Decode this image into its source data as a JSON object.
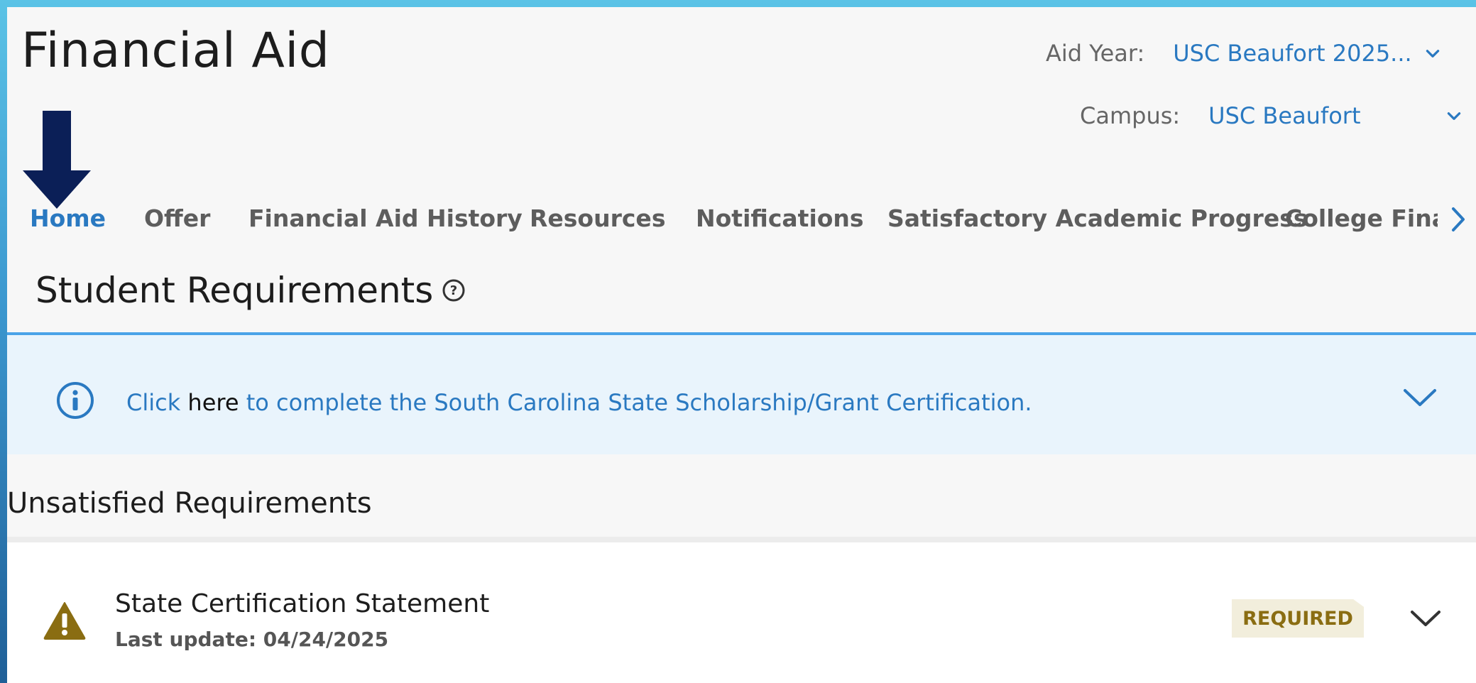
{
  "app": {
    "title": "Financial Aid"
  },
  "filters": {
    "aid_year": {
      "label": "Aid Year:",
      "value": "USC Beaufort 2025..."
    },
    "campus": {
      "label": "Campus:",
      "value": "USC Beaufort"
    }
  },
  "tabs": [
    {
      "label": "Home",
      "active": true
    },
    {
      "label": "Offer",
      "active": false
    },
    {
      "label": "Financial Aid History",
      "active": false
    },
    {
      "label": "Resources",
      "active": false
    },
    {
      "label": "Notifications",
      "active": false
    },
    {
      "label": "Satisfactory Academic Progress",
      "active": false
    },
    {
      "label": "College Financ",
      "active": false
    }
  ],
  "section": {
    "title": "Student Requirements"
  },
  "banner": {
    "prefix": "Click",
    "link_word": "here",
    "suffix": "to complete the South Carolina State Scholarship/Grant Certification."
  },
  "unsatisfied": {
    "title": "Unsatisfied Requirements",
    "items": [
      {
        "name": "State Certification Statement",
        "updated": "Last update: 04/24/2025",
        "status": "REQUIRED"
      }
    ]
  },
  "icons": {
    "marker": "down-arrow-icon",
    "help": "question-circle-icon",
    "info": "info-circle-icon",
    "warning": "warning-triangle-icon",
    "expand": "chevron-down-icon",
    "tab_scroll": "chevron-right-icon"
  },
  "colors": {
    "accent": "#2a79c1",
    "banner_bg": "#e9f4fc",
    "banner_border": "#4aa3e8",
    "warning": "#8a6d12",
    "badge_bg": "#f2eedc",
    "marker_arrow": "#0b1f57"
  }
}
